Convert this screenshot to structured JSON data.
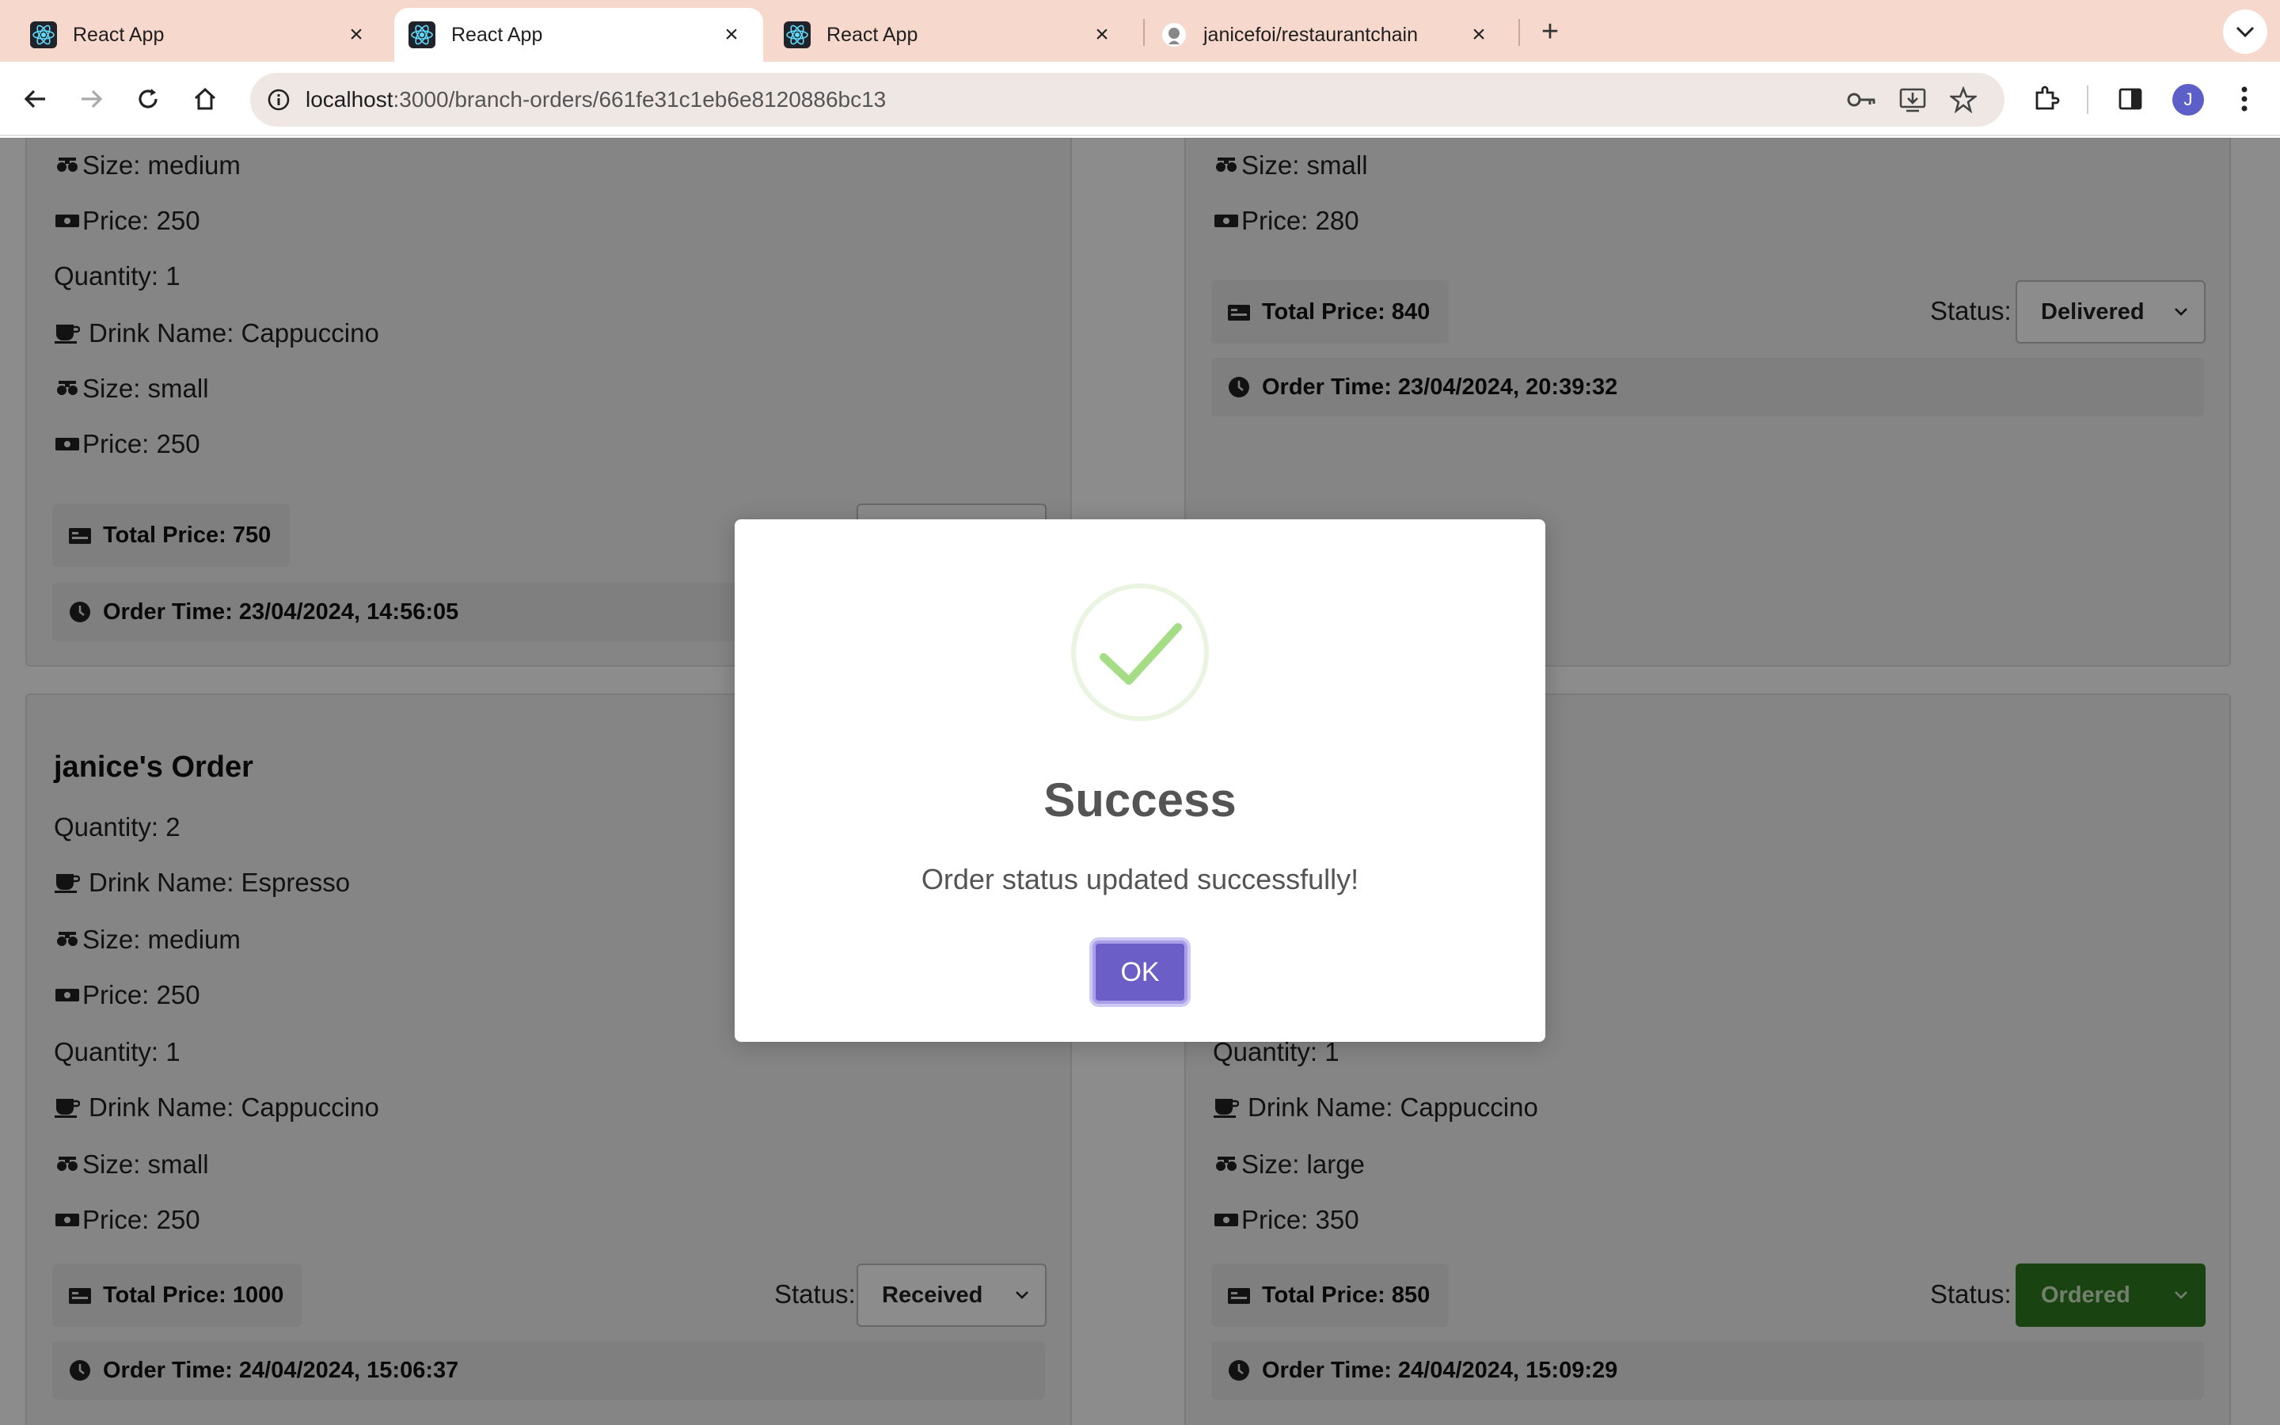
{
  "browser": {
    "tabs": [
      {
        "title": "React App",
        "icon": "react-icon",
        "active": false
      },
      {
        "title": "React App",
        "icon": "react-icon",
        "active": true
      },
      {
        "title": "React App",
        "icon": "react-icon",
        "active": false
      },
      {
        "title": "janicefoi/restaurantchain",
        "icon": "github-icon",
        "active": false
      }
    ],
    "url_host": "localhost",
    "url_path": ":3000/branch-orders/661fe31c1eb6e8120886bc13",
    "avatar_letter": "J"
  },
  "orders": {
    "top_left": {
      "rows": [
        "Size: medium",
        "Price: 250",
        "Quantity: 1",
        "Drink Name: Cappuccino",
        "Size: small",
        "Price: 250"
      ],
      "total": "Total Price: 750",
      "order_time": "Order Time: 23/04/2024, 14:56:05"
    },
    "top_right": {
      "rows": [
        "Size: small",
        "Price: 280"
      ],
      "total": "Total Price: 840",
      "status_label": "Status:",
      "status": "Delivered",
      "order_time": "Order Time: 23/04/2024, 20:39:32"
    },
    "bottom_left": {
      "title": "janice's Order",
      "rows": [
        "Quantity: 2",
        "Drink Name: Espresso",
        "Size: medium",
        "Price: 250",
        "Quantity: 1",
        "Drink Name: Cappuccino",
        "Size: small",
        "Price: 250"
      ],
      "total": "Total Price: 1000",
      "status_label": "Status:",
      "status": "Received",
      "order_time": "Order Time: 24/04/2024, 15:06:37"
    },
    "bottom_right": {
      "rows": [
        "Quantity: 1",
        "Drink Name: Cappuccino",
        "Size: large",
        "Price: 350"
      ],
      "total": "Total Price: 850",
      "status_label": "Status:",
      "status": "Ordered",
      "order_time": "Order Time: 24/04/2024, 15:09:29"
    }
  },
  "modal": {
    "title": "Success",
    "message": "Order status updated successfully!",
    "ok_label": "OK",
    "icon": "checkmark-icon",
    "accent": "#a5dc86"
  },
  "colors": {
    "tabbar": "#f6d8cc",
    "ok_button": "#6b5fc7",
    "ordered_status": "#2e7a1e"
  }
}
